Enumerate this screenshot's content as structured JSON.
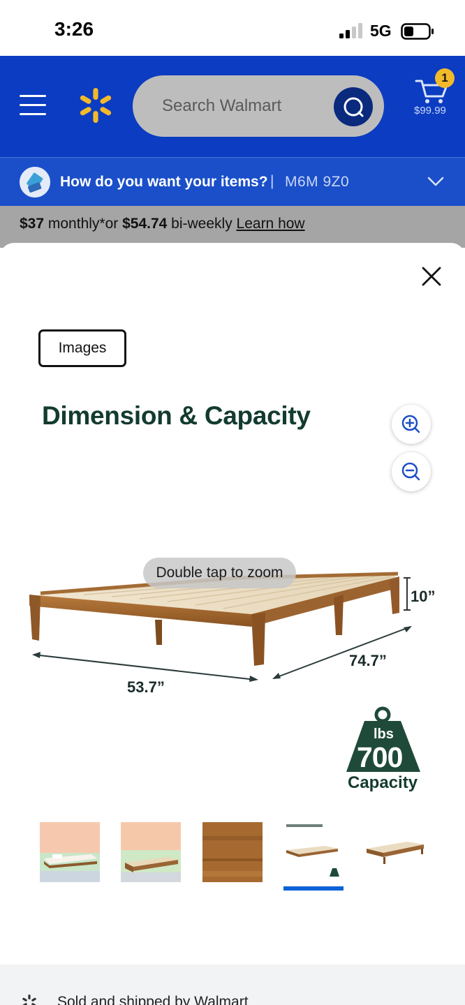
{
  "status_bar": {
    "time": "3:26",
    "network": "5G"
  },
  "header": {
    "search_placeholder": "Search Walmart",
    "cart_count": "1",
    "cart_total": "$99.99"
  },
  "delivery": {
    "prompt": "How do you want your items?",
    "separator": "|",
    "postal_code": "M6M 9Z0"
  },
  "finance": {
    "monthly_amount": "$37",
    "monthly_text": " monthly*or ",
    "biweekly_amount": "$54.74",
    "biweekly_text": " bi-weekly ",
    "link": "Learn how"
  },
  "modal": {
    "images_chip": "Images",
    "zoom_tip": "Double tap to zoom"
  },
  "product_image": {
    "title": "Dimension & Capacity",
    "height": "10”",
    "depth": "74.7”",
    "width": "53.7”",
    "weight_unit": "lbs",
    "weight_value": "700",
    "weight_caption": "Capacity"
  },
  "thumbnails": [
    {
      "name": "thumb-1",
      "selected": false
    },
    {
      "name": "thumb-2",
      "selected": false
    },
    {
      "name": "thumb-3",
      "selected": false
    },
    {
      "name": "thumb-4",
      "selected": true
    },
    {
      "name": "thumb-5",
      "selected": false
    }
  ],
  "footer": {
    "sold_by": "Sold and shipped by Walmart"
  },
  "colors": {
    "brand_blue": "#0b3cc1",
    "spark_yellow": "#f2b92b",
    "dark_green": "#133b2f"
  }
}
